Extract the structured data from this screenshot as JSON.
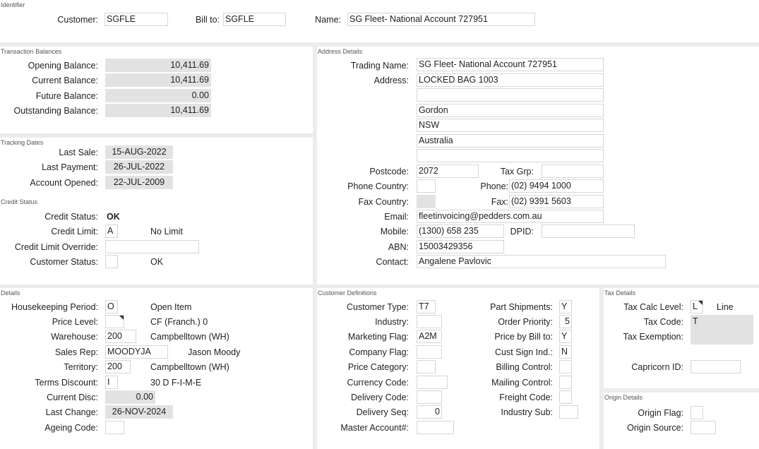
{
  "identifier": {
    "title": "Identifier",
    "customer_label": "Customer:",
    "customer": "SGFLE",
    "billto_label": "Bill to:",
    "billto": "SGFLE",
    "name_label": "Name:",
    "name": "SG Fleet-  National Account 727951"
  },
  "balances": {
    "title": "Transaction Balances",
    "opening_label": "Opening Balance:",
    "opening": "10,411.69",
    "current_label": "Current Balance:",
    "current": "10,411.69",
    "future_label": "Future Balance:",
    "future": "0.00",
    "outstanding_label": "Outstanding Balance:",
    "outstanding": "10,411.69"
  },
  "tracking": {
    "title": "Tracking Dates",
    "last_sale_label": "Last Sale:",
    "last_sale": "15-AUG-2022",
    "last_payment_label": "Last Payment:",
    "last_payment": "26-JUL-2022",
    "opened_label": "Account Opened:",
    "opened": "22-JUL-2009"
  },
  "credit": {
    "title": "Credit Status",
    "status_label": "Credit Status:",
    "status": "OK",
    "limit_label": "Credit Limit:",
    "limit": "A",
    "limit_desc": "No Limit",
    "override_label": "Credit Limit Override:",
    "override": "",
    "cust_status_label": "Customer Status:",
    "cust_status": "",
    "cust_status_desc": "OK"
  },
  "address": {
    "title": "Address Details",
    "trading_label": "Trading Name:",
    "trading": "SG Fleet-  National Account 727951",
    "address_label": "Address:",
    "lines": [
      "LOCKED BAG 1003",
      "",
      "Gordon",
      "NSW",
      "Australia",
      ""
    ],
    "postcode_label": "Postcode:",
    "postcode": "2072",
    "taxgrp_label": "Tax Grp:",
    "taxgrp": "",
    "phone_country_label": "Phone Country:",
    "phone_country": "",
    "phone_label": "Phone:",
    "phone": "(02) 9494 1000",
    "fax_country_label": "Fax Country:",
    "fax_country": "",
    "fax_label": "Fax:",
    "fax": "(02) 9391 5603",
    "email_label": "Email:",
    "email": "fleetinvoicing@pedders.com.au",
    "mobile_label": "Mobile:",
    "mobile": "(1300) 658 235",
    "dpid_label": "DPID:",
    "dpid": "",
    "abn_label": "ABN:",
    "abn": "15003429356",
    "contact_label": "Contact:",
    "contact": "Angalene Pavlovic"
  },
  "details": {
    "title": "Details",
    "housekeeping_label": "Housekeeping Period:",
    "housekeeping": "O",
    "housekeeping_desc": "Open Item",
    "price_level_label": "Price Level:",
    "price_level": "",
    "price_level_desc": "CF (Franch.) 0",
    "warehouse_label": "Warehouse:",
    "warehouse": "200",
    "warehouse_desc": "Campbelltown (WH)",
    "sales_rep_label": "Sales Rep:",
    "sales_rep": "MOODYJA",
    "sales_rep_desc": "Jason Moody",
    "territory_label": "Territory:",
    "territory": "200",
    "territory_desc": "Campbelltown (WH)",
    "terms_label": "Terms Discount:",
    "terms": "I",
    "terms_desc": "30 D F-I-M-E",
    "current_disc_label": "Current Disc:",
    "current_disc": "0.00",
    "last_change_label": "Last Change:",
    "last_change": "26-NOV-2024",
    "ageing_label": "Ageing Code:",
    "ageing": ""
  },
  "definitions": {
    "title": "Customer Definitions",
    "cust_type_label": "Customer Type:",
    "cust_type": "T7",
    "industry_label": "Industry:",
    "industry": "",
    "marketing_label": "Marketing Flag:",
    "marketing": "A2M",
    "company_label": "Company Flag:",
    "company": "",
    "price_cat_label": "Price Category:",
    "price_cat": "",
    "currency_label": "Currency Code:",
    "currency": "",
    "delivery_label": "Delivery Code:",
    "delivery": "",
    "delivery_seq_label": "Delivery Seq:",
    "delivery_seq": "0",
    "master_label": "Master Account#:",
    "master": "",
    "part_ship_label": "Part Shipments:",
    "part_ship": "Y",
    "order_priority_label": "Order Priority:",
    "order_priority": "5",
    "price_billto_label": "Price by Bill to:",
    "price_billto": "Y",
    "cust_sign_label": "Cust Sign Ind.:",
    "cust_sign": "N",
    "billing_label": "Billing Control:",
    "billing": "",
    "mailing_label": "Mailing Control:",
    "mailing": "",
    "freight_label": "Freight Code:",
    "freight": "",
    "industry_sub_label": "Industry Sub:",
    "industry_sub": ""
  },
  "tax": {
    "title": "Tax Details",
    "calc_level_label": "Tax Calc Level:",
    "calc_level": "L",
    "calc_level_desc": "Line",
    "code_label": "Tax Code:",
    "code": "T",
    "exemption_label": "Tax Exemption:",
    "capricorn_label": "Capricorn ID:",
    "capricorn": ""
  },
  "origin": {
    "title": "Origin Details",
    "flag_label": "Origin Flag:",
    "flag": "",
    "source_label": "Origin Source:",
    "source": ""
  }
}
